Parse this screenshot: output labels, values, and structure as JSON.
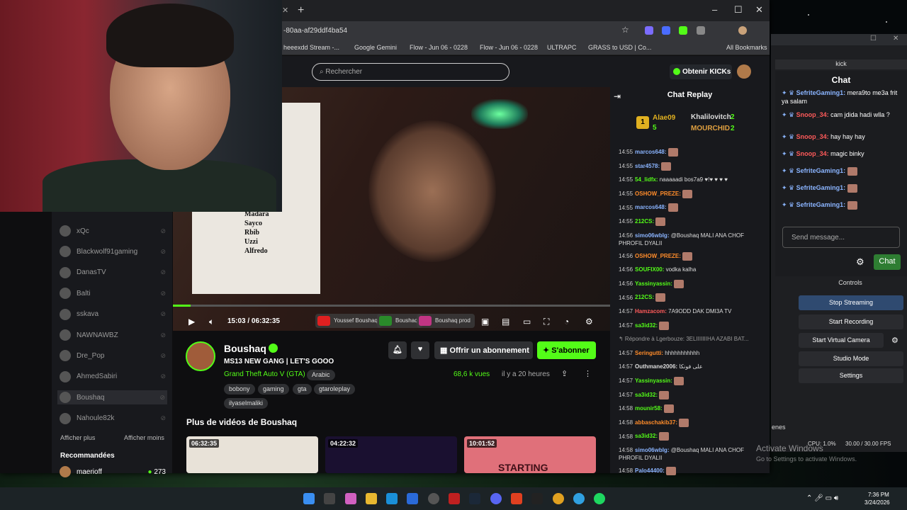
{
  "browser": {
    "url_fragment": "-80aa-af29ddf4ba54",
    "bookmarks": [
      "heeexdd Stream -...",
      "Google Gemini",
      "Flow - Jun 06 - 0228",
      "Flow - Jun 06 - 0228",
      "ULTRAPC",
      "GRASS to USD | Co...",
      "All Bookmarks"
    ]
  },
  "header": {
    "search_placeholder": "Rechercher",
    "kicks_button": "Obtenir KICKs"
  },
  "sidebar": {
    "channels": [
      "xQc",
      "Blackwolf91gaming",
      "DanasTV",
      "Balti",
      "sskava",
      "NAWNAWBZ",
      "Dre_Pop",
      "AhmedSabiri",
      "Boushaq",
      "Nahoule82k"
    ],
    "show_more": "Afficher plus",
    "show_less": "Afficher moins",
    "recommended_label": "Recommandées",
    "recommended": [
      {
        "name": "maerioff",
        "viewers": "273"
      }
    ]
  },
  "poster": {
    "names": [
      "Madara",
      "Sayco",
      "Rbib",
      "Uzzi",
      "Alfredo"
    ],
    "badge": "13"
  },
  "player": {
    "time": "15:03 / 06:32:35",
    "progress": 0.04,
    "socials": [
      "Youssef Boushaq",
      "Boushaq",
      "Boushaq prod"
    ]
  },
  "channel": {
    "name": "Boushaq",
    "stream_title": "MS13 NEW GANG | LET'S GOOO",
    "category": "Grand Theft Auto V (GTA)",
    "language": "Arabic",
    "tags": [
      "bobony",
      "gaming",
      "gta",
      "gtaroleplay",
      "ilyaselmaliki"
    ],
    "views": "68,6 k vues",
    "ago": "il y a 20 heures",
    "subscribe_label": "Offrir un abonnement",
    "follow_label": "S'abonner",
    "more_videos_label": "Plus de vidéos de Boushaq",
    "thumbs": [
      "06:32:35",
      "04:22:32",
      "10:01:52"
    ],
    "thumb3_text": "STARTING"
  },
  "chat_replay": {
    "title": "Chat Replay",
    "leaderboard": [
      {
        "rank": "1",
        "name": "Alae09",
        "count": "5"
      },
      {
        "name": "Khalilovitch",
        "count": "2"
      },
      {
        "name": "MOURCHID",
        "count": "2"
      }
    ],
    "messages": [
      {
        "time": "14:55",
        "user": "marcos648:",
        "text": "",
        "color": "#8ab4ff",
        "emote": true
      },
      {
        "time": "14:55",
        "user": "star4578:",
        "text": "",
        "color": "#8ab4ff",
        "emote": true
      },
      {
        "time": "14:55",
        "user": "54_lidfx:",
        "text": "naaaaadi bos7a9 ♥!♥ ♥ ♥ ♥",
        "color": "#53fc18",
        "emote": false
      },
      {
        "time": "14:55",
        "user": "OSHOW_PREZE:",
        "text": "",
        "color": "#ff8c2a",
        "emote": true
      },
      {
        "time": "14:55",
        "user": "marcos648:",
        "text": "",
        "color": "#8ab4ff",
        "emote": true
      },
      {
        "time": "14:55",
        "user": "212CS:",
        "text": "",
        "color": "#53fc18",
        "emote": true
      },
      {
        "time": "14:56",
        "user": "simo06wblg:",
        "text": "@Boushaq MALI ANA CHOF PHROFIL DYALII",
        "color": "#8ab4ff",
        "emote": false
      },
      {
        "time": "14:56",
        "user": "OSHOW_PREZE:",
        "text": "",
        "color": "#ff8c2a",
        "emote": true
      },
      {
        "time": "14:56",
        "user": "SOUFIX00:",
        "text": "vodka kalha",
        "color": "#53fc18",
        "emote": false
      },
      {
        "time": "14:56",
        "user": "Yassinyassin:",
        "text": "",
        "color": "#53fc18",
        "emote": true
      },
      {
        "time": "14:56",
        "user": "212CS:",
        "text": "",
        "color": "#53fc18",
        "emote": true
      },
      {
        "time": "14:57",
        "user": "Hamzacom:",
        "text": "7A9ODD DAK DMI3A TV",
        "color": "#ff5a5a",
        "emote": false
      },
      {
        "time": "14:57",
        "user": "sa3id32:",
        "text": "",
        "color": "#53fc18",
        "emote": true
      },
      {
        "time": "",
        "user": "",
        "text": "↰ Répondre à Lgerbouze: 3ELIIIIIIIHA AZABI BAT...",
        "color": "#aaa",
        "emote": false
      },
      {
        "time": "14:57",
        "user": "Seringutti:",
        "text": "hhhhhhhhhhh",
        "color": "#ff8c2a",
        "emote": false
      },
      {
        "time": "14:57",
        "user": "Outhmane2006:",
        "text": "على فونكا",
        "color": "#ddd",
        "emote": false
      },
      {
        "time": "14:57",
        "user": "Yassinyassin:",
        "text": "",
        "color": "#53fc18",
        "emote": true
      },
      {
        "time": "14:57",
        "user": "sa3id32:",
        "text": "",
        "color": "#53fc18",
        "emote": true
      },
      {
        "time": "14:58",
        "user": "mounir58:",
        "text": "",
        "color": "#53fc18",
        "emote": true
      },
      {
        "time": "14:58",
        "user": "abbaschakib37:",
        "text": "",
        "color": "#ff8c2a",
        "emote": true
      },
      {
        "time": "14:58",
        "user": "sa3id32:",
        "text": "",
        "color": "#53fc18",
        "emote": true
      },
      {
        "time": "14:58",
        "user": "simo06wblg:",
        "text": "@Boushaq MALI ANA CHOF PHROFIL DYALII",
        "color": "#8ab4ff",
        "emote": false
      },
      {
        "time": "14:58",
        "user": "Palo44400:",
        "text": "",
        "color": "#8ab4ff",
        "emote": true
      }
    ]
  },
  "obs": {
    "kick_dock_title": "kick",
    "chat_title": "Chat",
    "messages": [
      {
        "user": "SefriteGaming1:",
        "text": "mera9to me3a frit ya salam",
        "color": "#8ab4ff"
      },
      {
        "user": "Snoop_34:",
        "text": "cam jdida hadi wlla ?",
        "color": "#ff5a5a"
      },
      {
        "user": "Snoop_34:",
        "text": "hay hay hay",
        "color": "#ff5a5a"
      },
      {
        "user": "Snoop_34:",
        "text": "magic binky",
        "color": "#ff5a5a"
      },
      {
        "user": "SefriteGaming1:",
        "text": "",
        "color": "#8ab4ff"
      },
      {
        "user": "SefriteGaming1:",
        "text": "",
        "color": "#8ab4ff"
      },
      {
        "user": "SefriteGaming1:",
        "text": "",
        "color": "#8ab4ff"
      }
    ],
    "send_placeholder": "Send message...",
    "chat_button": "Chat",
    "controls_title": "Controls",
    "buttons": [
      "Stop Streaming",
      "Start Recording",
      "Start Virtual Camera",
      "Studio Mode",
      "Settings"
    ],
    "cpu": "CPU: 1.0%",
    "fps": "30.00 / 30.00 FPS",
    "scenes_label": "enes"
  },
  "windows": {
    "activate_title": "Activate Windows",
    "activate_sub": "Go to Settings to activate Windows.",
    "time": "7:36 PM",
    "date": "3/24/2026"
  }
}
